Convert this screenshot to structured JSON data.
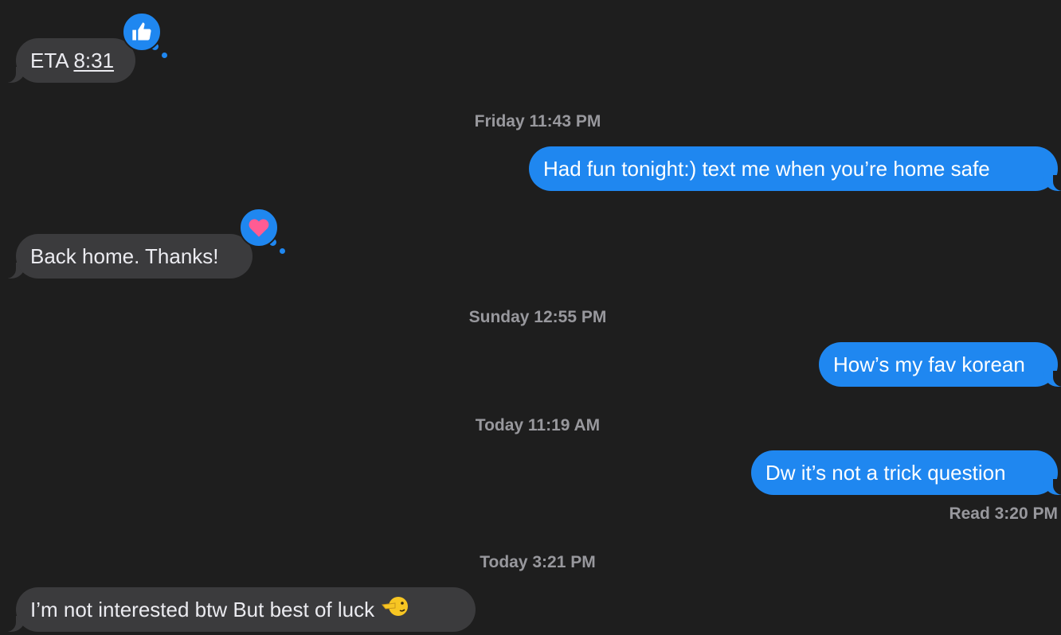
{
  "messages": {
    "m1": {
      "prefix": "ETA ",
      "link": "8:31",
      "reaction": "thumbs-up-icon"
    },
    "m2": {
      "text": "Had fun tonight:) text me when you’re home safe"
    },
    "m3": {
      "text": "Back home. Thanks!",
      "reaction": "heart-icon"
    },
    "m4": {
      "text": "How’s my fav korean"
    },
    "m5": {
      "text": "Dw it’s not a trick question"
    },
    "m6": {
      "text": "I’m not interested btw But best of luck",
      "emoji": "pointing-left-face-emoji"
    }
  },
  "timestamps": {
    "t1": "Friday 11:43 PM",
    "t2": "Sunday 12:55 PM",
    "t3": "Today 11:19 AM",
    "t4": "Today 3:21 PM"
  },
  "read_receipt": "Read 3:20 PM",
  "colors": {
    "background": "#1e1e1e",
    "incoming_bubble": "#3b3b3d",
    "outgoing_bubble": "#1f87f0",
    "timestamp_text": "#98989d",
    "heart": "#ff5c93"
  }
}
